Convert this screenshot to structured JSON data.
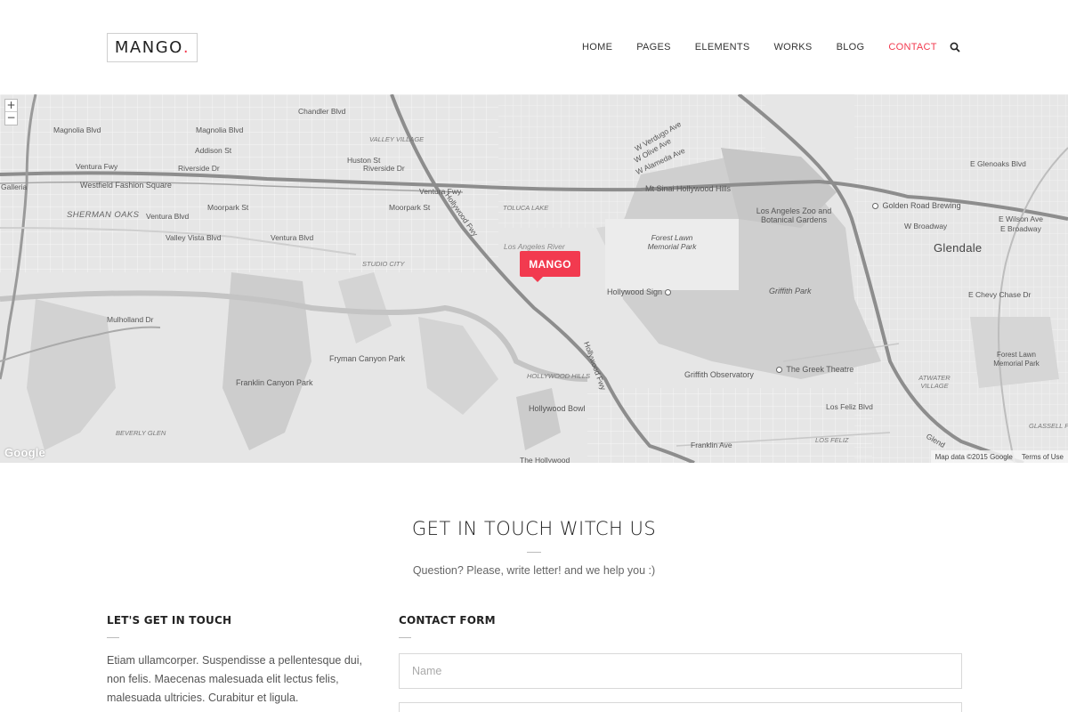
{
  "header": {
    "logo_text": "MANGO",
    "logo_dot": ".",
    "nav": [
      "HOME",
      "PAGES",
      "ELEMENTS",
      "WORKS",
      "BLOG",
      "CONTACT"
    ],
    "active_nav": "CONTACT",
    "search_icon": "search-icon"
  },
  "map": {
    "zoom_in": "+",
    "zoom_out": "−",
    "marker_label": "MANGO",
    "google_logo": "Google",
    "footer_data": "Map data ©2015 Google",
    "footer_terms": "Terms of Use",
    "labels": {
      "chandler": "Chandler Blvd",
      "magnolia": "Magnolia Blvd",
      "addison": "Addison St",
      "huston": "Huston St",
      "riverside": "Riverside Dr",
      "valley_village": "VALLEY VILLAGE",
      "ventura_fwy": "Ventura Fwy",
      "westfield": "Westfield Fashion Square",
      "galleria": "Galleria",
      "sherman_oaks": "SHERMAN OAKS",
      "ventura_blvd": "Ventura Blvd",
      "valley_vista": "Valley Vista Blvd",
      "moorpark": "Moorpark St",
      "toluca_lake": "TOLUCA LAKE",
      "studio_city": "STUDIO CITY",
      "la_river": "Los Angeles River",
      "mulholland": "Mulholland Dr",
      "fryman": "Fryman Canyon Park",
      "franklin_canyon": "Franklin Canyon Park",
      "beverly_glen": "BEVERLY GLEN",
      "hollywood_hills": "HOLLYWOOD HILLS",
      "hollywood_bowl": "Hollywood Bowl",
      "hollywood_sign": "Hollywood Sign",
      "forest_lawn": "Forest Lawn Memorial Park",
      "mt_sinai": "Mt Sinai Hollywood Hills",
      "la_zoo": "Los Angeles Zoo and Botanical Gardens",
      "griffith_park": "Griffith Park",
      "griffith_obs": "Griffith Observatory",
      "greek": "The Greek Theatre",
      "golden_road": "Golden Road Brewing",
      "glendale": "Glendale",
      "w_broadway": "W Broadway",
      "e_wilson": "E Wilson Ave",
      "e_broadway": "E Broadway",
      "e_glenoaks": "E Glenoaks Blvd",
      "e_chevy": "E Chevy Chase Dr",
      "forest_lawn2": "Forest Lawn Memorial Park",
      "atwater": "ATWATER VILLAGE",
      "los_feliz": "LOS FELIZ",
      "los_feliz_blvd": "Los Feliz Blvd",
      "franklin_ave": "Franklin Ave",
      "the_hollywood": "The Hollywood",
      "w_verdugo": "W Verdugo Ave",
      "w_olive": "W Olive Ave",
      "w_alameda": "W Alameda Ave",
      "hollywood_fwy": "Hollywood Fwy",
      "glassell": "GLASSELL P",
      "glend": "Glend"
    }
  },
  "contact": {
    "title": "GET IN TOUCH WITCH US",
    "subtitle": "Question? Please, write letter! and we help you :)",
    "left_title": "LET'S GET IN TOUCH",
    "left_text": "Etiam ullamcorper. Suspendisse a pellentesque dui, non felis. Maecenas malesuada elit lectus felis, malesuada ultricies. Curabitur et ligula.",
    "form_title": "CONTACT FORM",
    "name_placeholder": "Name"
  },
  "colors": {
    "accent": "#f23a4f",
    "map_bg": "#e9e9e9"
  }
}
